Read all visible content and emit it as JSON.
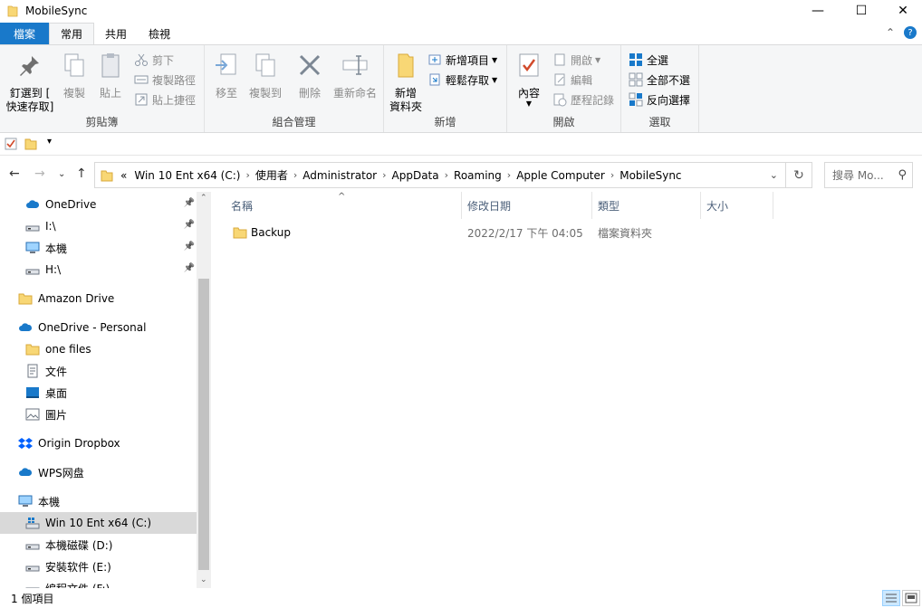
{
  "window": {
    "title": "MobileSync",
    "minimize": "—",
    "maximize": "☐",
    "close": "✕"
  },
  "tabs": [
    "檔案",
    "常用",
    "共用",
    "檢視"
  ],
  "ribbon": {
    "clipboard": {
      "label": "剪貼簿",
      "pin": "釘選到 [\n快速存取]",
      "pin_l1": "釘選到 [",
      "pin_l2": "快速存取]",
      "copy": "複製",
      "paste": "貼上",
      "cut": "剪下",
      "copy_path": "複製路徑",
      "paste_shortcut": "貼上捷徑"
    },
    "organize": {
      "label": "組合管理",
      "move_to": "移至",
      "copy_to": "複製到",
      "delete": "刪除",
      "rename": "重新命名"
    },
    "new": {
      "label": "新增",
      "new_folder_l1": "新增",
      "new_folder_l2": "資料夾",
      "new_item": "新增項目",
      "easy_access": "輕鬆存取"
    },
    "open": {
      "label": "開啟",
      "properties": "內容",
      "open": "開啟",
      "edit": "編輯",
      "history": "歷程記錄"
    },
    "select": {
      "label": "選取",
      "select_all": "全選",
      "select_none": "全部不選",
      "invert": "反向選擇"
    }
  },
  "address": {
    "overflow": "«",
    "crumbs": [
      "Win 10 Ent x64 (C:)",
      "使用者",
      "Administrator",
      "AppData",
      "Roaming",
      "Apple Computer",
      "MobileSync"
    ],
    "search_placeholder": "搜尋 Mo..."
  },
  "nav": {
    "items": [
      {
        "label": "OneDrive",
        "icon": "cloud-icon",
        "pinned": true
      },
      {
        "label": "I:\\",
        "icon": "drive-icon",
        "pinned": true
      },
      {
        "label": "本機",
        "icon": "computer-icon",
        "pinned": true
      },
      {
        "label": "H:\\",
        "icon": "drive-icon",
        "pinned": true
      },
      {
        "label": "Amazon Drive",
        "icon": "folder-icon"
      },
      {
        "label": "OneDrive - Personal",
        "icon": "cloud-icon"
      },
      {
        "label": "one files",
        "icon": "folder-icon"
      },
      {
        "label": "文件",
        "icon": "document-icon"
      },
      {
        "label": "桌面",
        "icon": "desktop-icon"
      },
      {
        "label": "圖片",
        "icon": "pictures-icon"
      },
      {
        "label": "Origin Dropbox",
        "icon": "dropbox-icon"
      },
      {
        "label": "WPS网盘",
        "icon": "cloud-icon"
      },
      {
        "label": "本機",
        "icon": "computer-icon"
      },
      {
        "label": "Win 10 Ent x64 (C:)",
        "icon": "windows-drive-icon",
        "selected": true
      },
      {
        "label": "本機磁碟 (D:)",
        "icon": "drive-icon"
      },
      {
        "label": "安裝软件 (E:)",
        "icon": "drive-icon"
      },
      {
        "label": "编程文件 (F:)",
        "icon": "drive-icon"
      }
    ]
  },
  "columns": [
    "名稱",
    "修改日期",
    "類型",
    "大小"
  ],
  "files": [
    {
      "name": "Backup",
      "modified": "2022/2/17 下午 04:05",
      "type": "檔案資料夾",
      "size": ""
    }
  ],
  "status": {
    "count": "1 個項目"
  },
  "colors": {
    "accent": "#1979ca",
    "selection": "#d9d9d9",
    "folder": "#f8d775"
  }
}
